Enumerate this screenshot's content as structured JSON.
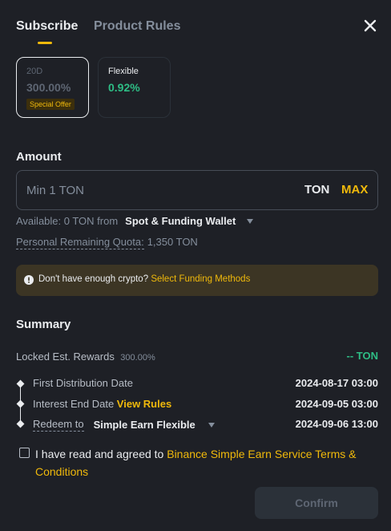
{
  "tabs": [
    {
      "label": "Subscribe",
      "active": true
    },
    {
      "label": "Product Rules",
      "active": false
    }
  ],
  "terms": [
    {
      "duration": "20D",
      "rate": "300.00%",
      "badge": "Special Offer",
      "selected": true
    },
    {
      "duration": "Flexible",
      "rate": "0.92%",
      "selected": false
    }
  ],
  "amount": {
    "title": "Amount",
    "placeholder": "Min 1 TON",
    "value": "",
    "unit": "TON",
    "max_label": "MAX"
  },
  "available": {
    "text": "Available: 0 TON from",
    "wallet": "Spot & Funding Wallet"
  },
  "quota": {
    "label": "Personal Remaining Quota:",
    "value": "1,350 TON"
  },
  "notice": {
    "text": "Don't have enough crypto?",
    "link": "Select Funding Methods"
  },
  "summary": {
    "title": "Summary",
    "rewards_label": "Locked Est. Rewards",
    "rewards_rate": "300.00%",
    "rewards_value": "-- TON",
    "first_distribution_label": "First Distribution Date",
    "first_distribution_value": "2024-08-17 03:00",
    "interest_end_label": "Interest End Date",
    "interest_end_link": "View Rules",
    "interest_end_value": "2024-09-05 03:00",
    "redeem_label": "Redeem to",
    "redeem_target": "Simple Earn Flexible",
    "redeem_value": "2024-09-06 13:00"
  },
  "agreement": {
    "text": "I have read and agreed to",
    "link": "Binance Simple Earn Service Terms & Conditions",
    "checked": false
  },
  "confirm_label": "Confirm",
  "colors": {
    "background": "#1e2026",
    "accent": "#f0b90b",
    "positive": "#2ebd85",
    "notice_bg": "#3c3524"
  }
}
